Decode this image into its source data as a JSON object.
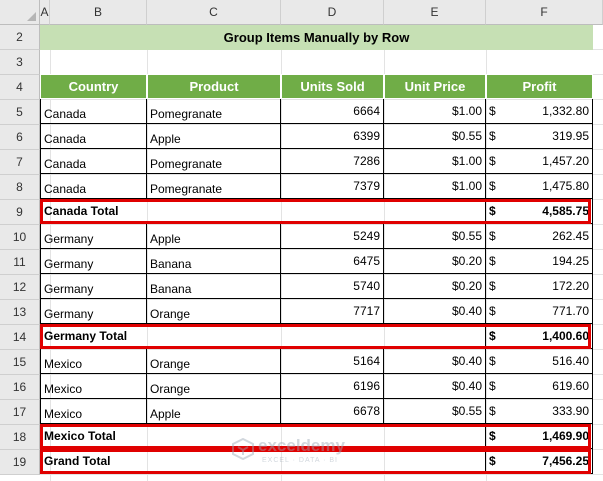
{
  "sheet": {
    "columns": [
      "A",
      "B",
      "C",
      "D",
      "E",
      "F"
    ],
    "row_numbers": [
      "2",
      "3",
      "4",
      "5",
      "6",
      "7",
      "8",
      "9",
      "10",
      "11",
      "12",
      "13",
      "14",
      "15",
      "16",
      "17",
      "18",
      "19"
    ]
  },
  "title": "Group Items Manually by Row",
  "table": {
    "headers": {
      "country": "Country",
      "product": "Product",
      "units": "Units Sold",
      "price": "Unit Price",
      "profit": "Profit"
    },
    "currency": "$",
    "rows": [
      {
        "country": "Canada",
        "product": "Pomegranate",
        "units": "6664",
        "price": "$1.00",
        "profit": "1,332.80"
      },
      {
        "country": "Canada",
        "product": "Apple",
        "units": "6399",
        "price": "$0.55",
        "profit": "319.95"
      },
      {
        "country": "Canada",
        "product": "Pomegranate",
        "units": "7286",
        "price": "$1.00",
        "profit": "1,457.20"
      },
      {
        "country": "Canada",
        "product": "Pomegranate",
        "units": "7379",
        "price": "$1.00",
        "profit": "1,475.80"
      },
      {
        "label": "Canada Total",
        "profit": "4,585.75"
      },
      {
        "country": "Germany",
        "product": "Apple",
        "units": "5249",
        "price": "$0.55",
        "profit": "262.45"
      },
      {
        "country": "Germany",
        "product": "Banana",
        "units": "6475",
        "price": "$0.20",
        "profit": "194.25"
      },
      {
        "country": "Germany",
        "product": "Banana",
        "units": "5740",
        "price": "$0.20",
        "profit": "172.20"
      },
      {
        "country": "Germany",
        "product": "Orange",
        "units": "7717",
        "price": "$0.40",
        "profit": "771.70"
      },
      {
        "label": "Germany Total",
        "profit": "1,400.60"
      },
      {
        "country": "Mexico",
        "product": "Orange",
        "units": "5164",
        "price": "$0.40",
        "profit": "516.40"
      },
      {
        "country": "Mexico",
        "product": "Orange",
        "units": "6196",
        "price": "$0.40",
        "profit": "619.60"
      },
      {
        "country": "Mexico",
        "product": "Apple",
        "units": "6678",
        "price": "$0.55",
        "profit": "333.90"
      },
      {
        "label": "Mexico Total",
        "profit": "1,469.90"
      },
      {
        "label": "Grand Total",
        "profit": "7,456.25"
      }
    ]
  },
  "watermark": {
    "name": "exceldemy",
    "tagline": "EXCEL · DATA · BI"
  },
  "colors": {
    "header_green": "#70ad47",
    "title_green": "#c6e0b4",
    "highlight_red": "#e00000"
  }
}
